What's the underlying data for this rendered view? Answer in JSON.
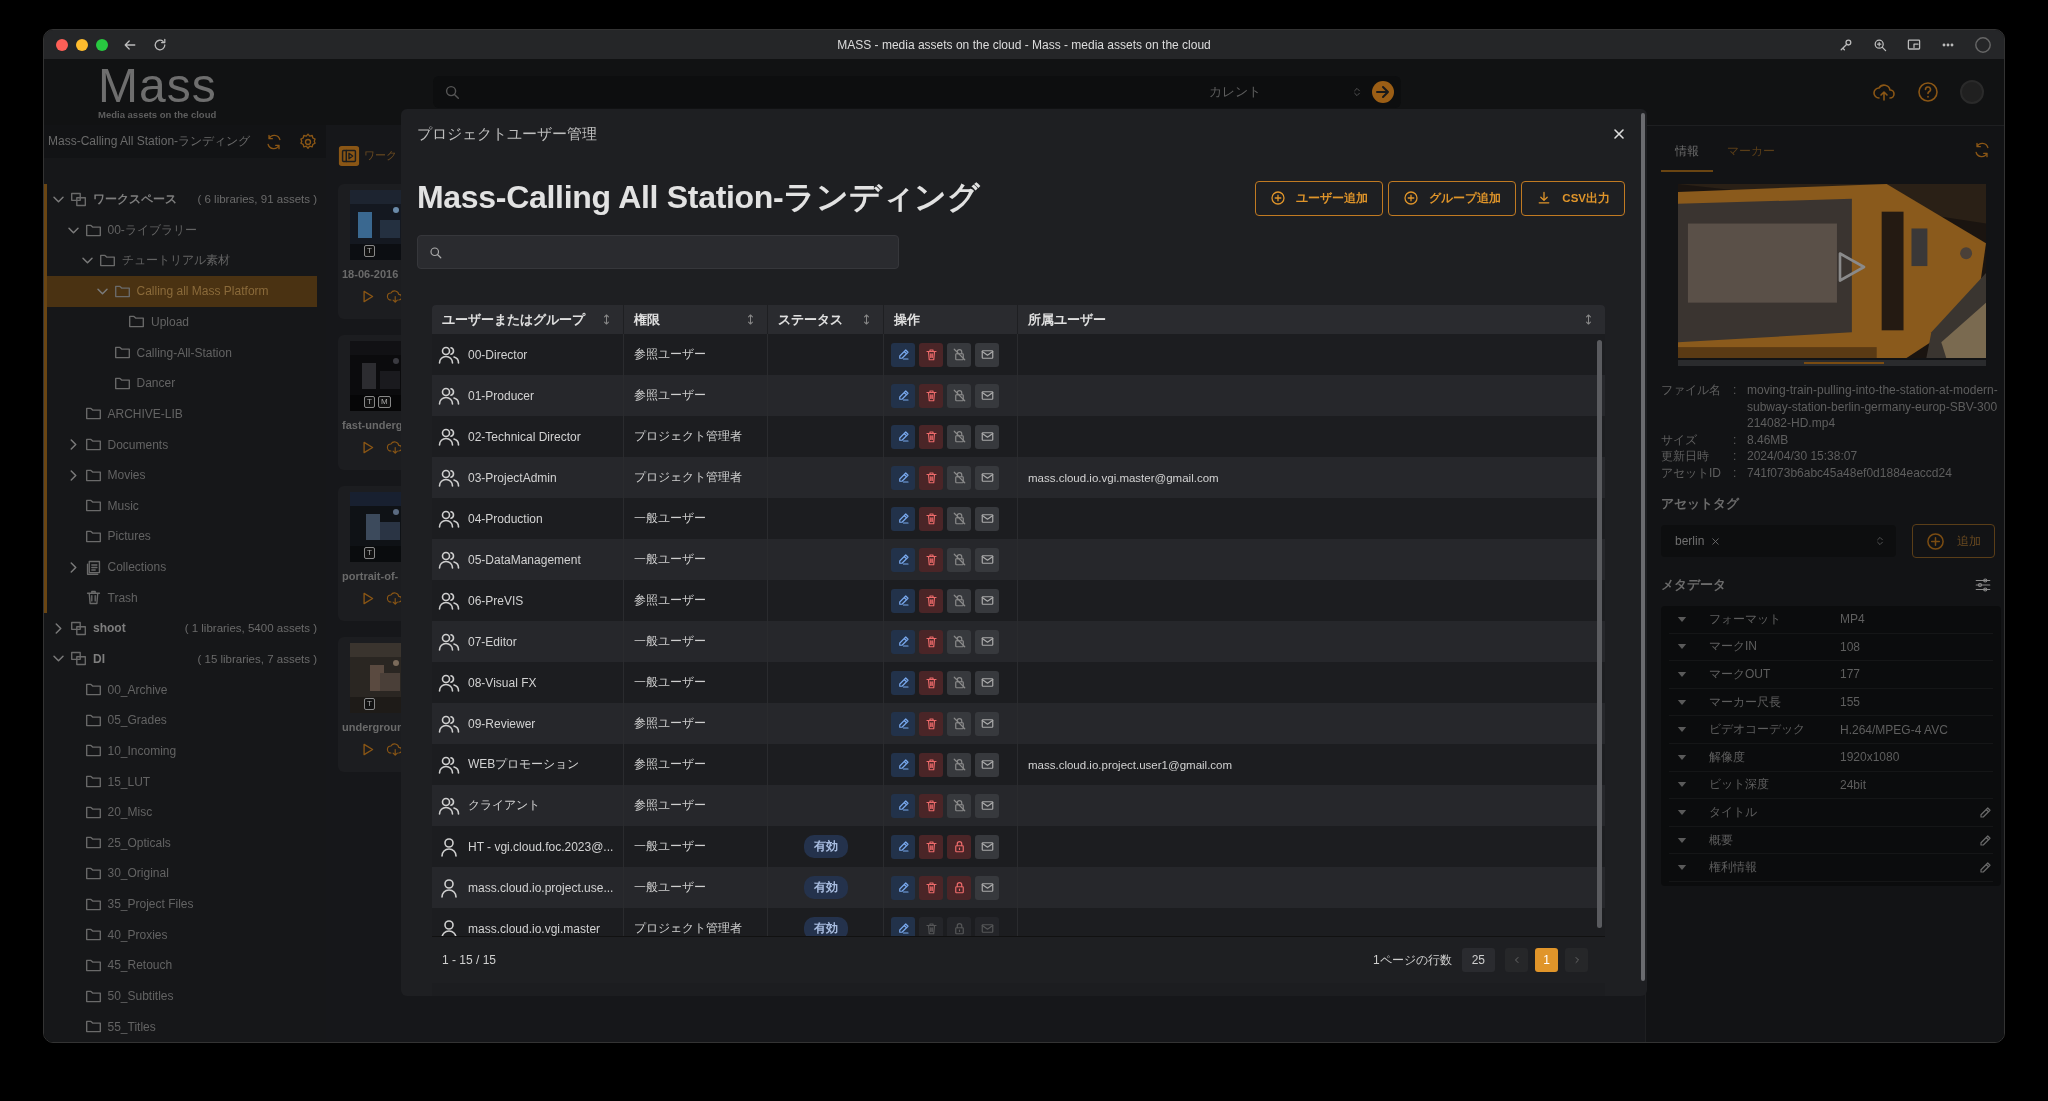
{
  "browser": {
    "title": "MASS - media assets on the cloud - Mass - media assets on the cloud"
  },
  "header": {
    "logo": "Mass",
    "tagline": "Media assets on the cloud",
    "search_scope": "カレント"
  },
  "sidebar": {
    "project": "Mass-Calling All Station-ランディング",
    "tree": [
      {
        "label": "ワークスペース",
        "kind": "workspace",
        "count": "( 6 libraries, 91 assets )",
        "expanded": true,
        "selected": false,
        "children": [
          {
            "label": "00-ライブラリー",
            "kind": "folder",
            "expanded": true,
            "selected": false,
            "children": [
              {
                "label": "チュートリアル素材",
                "kind": "folder",
                "expanded": true,
                "selected": false,
                "children": [
                  {
                    "label": "Calling all Mass Platform",
                    "kind": "folder",
                    "expanded": true,
                    "selected": true,
                    "children": [
                      {
                        "label": "Upload",
                        "kind": "folder",
                        "selected": false
                      }
                    ]
                  },
                  {
                    "label": "Calling-All-Station",
                    "kind": "folder",
                    "selected": false
                  },
                  {
                    "label": "Dancer",
                    "kind": "folder",
                    "selected": false
                  }
                ]
              }
            ]
          },
          {
            "label": "ARCHIVE-LIB",
            "kind": "folder",
            "selected": false
          },
          {
            "label": "Documents",
            "kind": "folder",
            "expanded": false,
            "selected": false
          },
          {
            "label": "Movies",
            "kind": "folder",
            "expanded": false,
            "selected": false
          },
          {
            "label": "Music",
            "kind": "folder",
            "selected": false
          },
          {
            "label": "Pictures",
            "kind": "folder",
            "selected": false
          },
          {
            "label": "Collections",
            "kind": "collection",
            "expanded": false,
            "selected": false
          },
          {
            "label": "Trash",
            "kind": "trash",
            "selected": false
          }
        ]
      },
      {
        "label": "shoot",
        "kind": "workspace",
        "count": "( 1 libraries, 5400 assets )",
        "expanded": false,
        "selected": false
      },
      {
        "label": "DI",
        "kind": "workspace",
        "count": "( 15 libraries, 7 assets )",
        "expanded": true,
        "selected": false,
        "children": [
          {
            "label": "00_Archive",
            "kind": "folder",
            "selected": false
          },
          {
            "label": "05_Grades",
            "kind": "folder",
            "selected": false
          },
          {
            "label": "10_Incoming",
            "kind": "folder",
            "selected": false
          },
          {
            "label": "15_LUT",
            "kind": "folder",
            "selected": false
          },
          {
            "label": "20_Misc",
            "kind": "folder",
            "selected": false
          },
          {
            "label": "25_Opticals",
            "kind": "folder",
            "selected": false
          },
          {
            "label": "30_Original",
            "kind": "folder",
            "selected": false
          },
          {
            "label": "35_Project Files",
            "kind": "folder",
            "selected": false
          },
          {
            "label": "40_Proxies",
            "kind": "folder",
            "selected": false
          },
          {
            "label": "45_Retouch",
            "kind": "folder",
            "selected": false
          },
          {
            "label": "50_Subtitles",
            "kind": "folder",
            "selected": false
          },
          {
            "label": "55_Titles",
            "kind": "folder",
            "selected": false
          }
        ]
      }
    ]
  },
  "thumbnails": {
    "heading": "ワーク",
    "items": [
      {
        "name": "18-06-2016",
        "badges": [
          "T"
        ]
      },
      {
        "name": "fast-underg",
        "badges": [
          "T",
          "M"
        ]
      },
      {
        "name": "portrait-of-",
        "badges": [
          "T"
        ]
      },
      {
        "name": "undergroun",
        "badges": [
          "T"
        ]
      }
    ]
  },
  "modal": {
    "title": "プロジェクトユーザー管理",
    "heading": "Mass-Calling All Station-ランディング",
    "buttons": [
      {
        "label": "ユーザー追加",
        "kind": "add"
      },
      {
        "label": "グループ追加",
        "kind": "add"
      },
      {
        "label": "CSV出力",
        "kind": "export"
      }
    ],
    "columns": [
      {
        "label": "ユーザーまたはグループ",
        "sortable": true
      },
      {
        "label": "権限",
        "sortable": true
      },
      {
        "label": "ステータス",
        "sortable": true
      },
      {
        "label": "操作",
        "sortable": false
      },
      {
        "label": "所属ユーザー",
        "sortable": true
      }
    ],
    "rows": [
      {
        "kind": "group",
        "name": "00-Director",
        "role": "参照ユーザー",
        "actions_disabled": false
      },
      {
        "kind": "group",
        "name": "01-Producer",
        "role": "参照ユーザー",
        "actions_disabled": false
      },
      {
        "kind": "group",
        "name": "02-Technical Director",
        "role": "プロジェクト管理者",
        "actions_disabled": false
      },
      {
        "kind": "group",
        "name": "03-ProjectAdmin",
        "role": "プロジェクト管理者",
        "members": "mass.cloud.io.vgi.master@gmail.com",
        "actions_disabled": false
      },
      {
        "kind": "group",
        "name": "04-Production",
        "role": "一般ユーザー",
        "actions_disabled": false
      },
      {
        "kind": "group",
        "name": "05-DataManagement",
        "role": "一般ユーザー",
        "actions_disabled": false
      },
      {
        "kind": "group",
        "name": "06-PreVIS",
        "role": "参照ユーザー",
        "actions_disabled": false
      },
      {
        "kind": "group",
        "name": "07-Editor",
        "role": "一般ユーザー",
        "actions_disabled": false
      },
      {
        "kind": "group",
        "name": "08-Visual FX",
        "role": "一般ユーザー",
        "actions_disabled": false
      },
      {
        "kind": "group",
        "name": "09-Reviewer",
        "role": "参照ユーザー",
        "actions_disabled": false
      },
      {
        "kind": "group",
        "name": "WEBプロモーション",
        "role": "参照ユーザー",
        "members": "mass.cloud.io.project.user1@gmail.com",
        "actions_disabled": false
      },
      {
        "kind": "group",
        "name": "クライアント",
        "role": "参照ユーザー",
        "actions_disabled": false
      },
      {
        "kind": "user",
        "name": "HT - vgi.cloud.foc.2023@...",
        "role": "一般ユーザー",
        "status": "有効",
        "actions_disabled": false
      },
      {
        "kind": "user",
        "name": "mass.cloud.io.project.use...",
        "role": "一般ユーザー",
        "status": "有効",
        "actions_disabled": false
      },
      {
        "kind": "user",
        "name": "mass.cloud.io.vgi.master",
        "role": "プロジェクト管理者",
        "status": "有効",
        "actions_disabled": true
      }
    ],
    "footer": {
      "range": "1 - 15 / 15",
      "rows_per_page_label": "1ページの行数",
      "rows_per_page": "25",
      "pages": [
        {
          "label": "1",
          "selected": true
        }
      ]
    }
  },
  "info_panel": {
    "tabs": [
      {
        "label": "情報",
        "selected": true
      },
      {
        "label": "マーカー",
        "selected": false
      }
    ],
    "file": [
      {
        "label": "ファイル名",
        "colon": ":",
        "value": "moving-train-pulling-into-the-station-at-modern-subway-station-berlin-germany-europ-SBV-300214082-HD.mp4"
      },
      {
        "label": "サイズ",
        "colon": ":",
        "value": "8.46MB"
      },
      {
        "label": "更新日時",
        "colon": ":",
        "value": "2024/04/30 15:38:07"
      },
      {
        "label": "アセットID",
        "colon": ":",
        "value": "741f073b6abc45a48ef0d1884eaccd24"
      }
    ],
    "tag_heading": "アセットタグ",
    "tags": [
      "berlin"
    ],
    "add_label": "追加",
    "metadata_heading": "メタデータ",
    "metadata": [
      {
        "label": "フォーマット",
        "value": "MP4",
        "editable": false
      },
      {
        "label": "マークIN",
        "value": "108",
        "editable": false
      },
      {
        "label": "マークOUT",
        "value": "177",
        "editable": false
      },
      {
        "label": "マーカー尺長",
        "value": "155",
        "editable": false
      },
      {
        "label": "ビデオコーデック",
        "value": "H.264/MPEG-4 AVC",
        "editable": false
      },
      {
        "label": "解像度",
        "value": "1920x1080",
        "editable": false
      },
      {
        "label": "ビット深度",
        "value": "24bit",
        "editable": false
      },
      {
        "label": "タイトル",
        "editable": true
      },
      {
        "label": "概要",
        "editable": true
      },
      {
        "label": "権利情報",
        "editable": true
      }
    ]
  }
}
